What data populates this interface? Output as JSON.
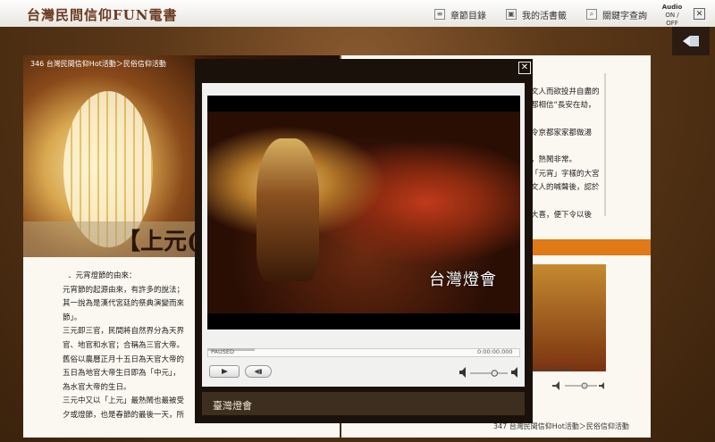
{
  "app": {
    "logo_text": "台灣民間信仰FUN電書",
    "nav": [
      "章節目錄",
      "我的活書籤",
      "關鍵字查詢"
    ],
    "audio_toggle": "ON / OFF",
    "audio_label": "Audio"
  },
  "left_page": {
    "header": "346  台灣民間信仰Hot活動＞民俗信仰活動",
    "big_title": "【上元(",
    "paragraphs": [
      "．元宵燈節的由來：",
      "元宵節的起源由來，有許多的說法；",
      "其一說為是漢代宮廷的祭典演變而來",
      "節」。",
      "三元即三官，民間將自然界分為天界",
      "官、地官和水官；合稱為三官大帝。",
      "舊俗以農曆正月十五日為天官大帝的",
      "五日為地官大帝生日即為「中元」，",
      "為水官大帝的生日。",
      "三元中又以「上元」最熱鬧也最被受",
      "夕或燈節，也是春節的最後一天，所"
    ]
  },
  "right_page": {
    "lines": [
      "文人而欲投井自盡的",
      "都相信“長安在劫，",
      "",
      "令京都家家都做湯",
      "",
      "，熱鬧非常。",
      "「元宵」字樣的大宮",
      "文人的喊聲後，認於",
      "",
      "大喜，便下令以後"
    ],
    "video_time": "0:00:00.480",
    "footer": "347  台灣民間信仰Hot活動＞民俗信仰活動"
  },
  "player": {
    "status": "PAUSED",
    "time": "0:00:00.000",
    "watermark": "台灣燈會",
    "caption": "臺灣燈會",
    "progress": 0.15,
    "volume": 0.65
  },
  "icons": {
    "close": "close-icon",
    "back": "back-arrow-icon",
    "play": "play-icon",
    "stop": "stop-icon",
    "speaker": "speaker-icon"
  },
  "colors": {
    "accent_orange": "#e07a16",
    "modal_bg": "#1a120a",
    "caption_bg": "#3e2e20"
  }
}
